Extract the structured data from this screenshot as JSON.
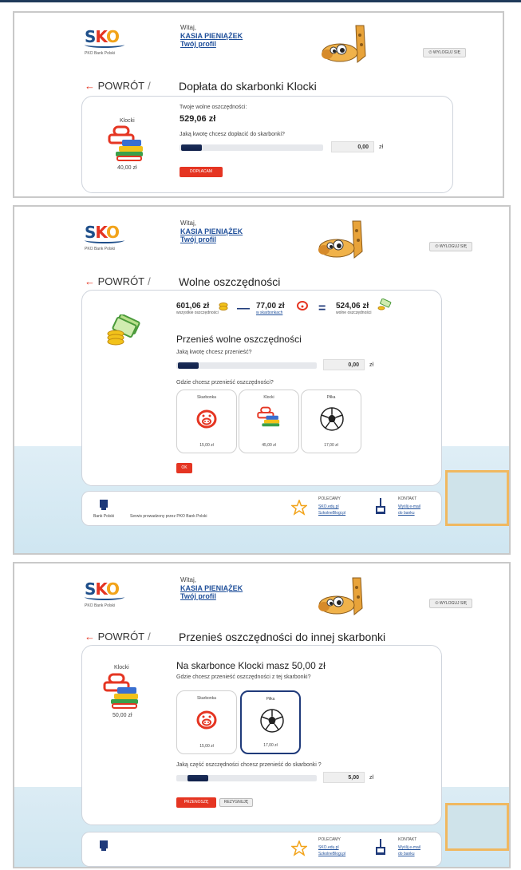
{
  "common": {
    "logo_text": [
      "S",
      "K",
      "O"
    ],
    "logo_sub": "PKO Bank Polski",
    "greeting": "Witaj,",
    "user_name": "KASIA PIENIĄŻEK",
    "profile_link": "Twój profil",
    "logout_label": "WYLOGUJ SIĘ",
    "back_label": "POWRÓT",
    "slash": "/",
    "currency": "zł",
    "colors": {
      "red": "#e53522",
      "navy": "#1f3a7a",
      "accent_blue": "#1f4f9a"
    }
  },
  "panel1": {
    "title": "Dopłata do skarbonki Klocki",
    "item_name": "Klocki",
    "item_value": "40,00 zł",
    "free_label": "Twoje wolne oszczędności:",
    "free_amount": "529,06 zł",
    "question": "Jaką kwotę chcesz dopłacić do skarbonki?",
    "amount": "0,00",
    "button": "DOPŁACAM"
  },
  "panel2": {
    "title": "Wolne oszczędności",
    "sum_all": "601,06 zł",
    "sum_all_label": "wszystkie oszczędności",
    "minus": "—",
    "sum_piggy": "77,00 zł",
    "sum_piggy_label": "w skarbonkach",
    "equals": "=",
    "sum_free": "524,06 zł",
    "sum_free_label": "wolne oszczędności",
    "heading": "Przenieś wolne oszczędności",
    "question": "Jaką kwotę chcesz przenieść?",
    "amount": "0,00",
    "where_question": "Gdzie chcesz przenieść oszczędności?",
    "tiles": [
      {
        "name": "Skarbonka",
        "value": "15,00 zł",
        "icon": "piggy-icon"
      },
      {
        "name": "Klocki",
        "value": "45,00 zł",
        "icon": "blocks-icon"
      },
      {
        "name": "Piłka",
        "value": "17,00 zł",
        "icon": "ball-icon"
      }
    ],
    "button": "OK",
    "footer": {
      "bank": "Bank Polski",
      "service": "Serwis prowadzony przez PKO Bank Polski",
      "recommend_label": "POLECAMY",
      "recommend_link1": "SKO.edu.pl",
      "recommend_link2": "SzkolneBlogi.pl",
      "contact_label": "KONTAKT",
      "contact_link1": "Wyślij e-mail",
      "contact_link2": "do banku"
    }
  },
  "panel3": {
    "title": "Przenieś oszczędności do innej skarbonki",
    "item_name": "Klocki",
    "item_value": "50,00 zł",
    "heading": "Na skarbonce Klocki masz 50,00 zł",
    "where_question": "Gdzie chcesz przenieść oszczędności z tej skarbonki?",
    "tiles": [
      {
        "name": "Skarbonka",
        "value": "15,00 zł",
        "icon": "piggy-icon"
      },
      {
        "name": "Piłka",
        "value": "17,00 zł",
        "icon": "ball-icon"
      }
    ],
    "question": "Jaką część oszczędności chcesz przenieść do skarbonki ?",
    "amount": "5,00",
    "button_primary": "PRZENOSZĘ",
    "button_secondary": "REZYGNUJĘ",
    "footer": {
      "recommend_label": "POLECAMY",
      "recommend_link1": "SKO.edu.pl",
      "recommend_link2": "SzkolneBlogi.pl",
      "contact_label": "KONTAKT",
      "contact_link1": "Wyślij e-mail",
      "contact_link2": "do banku"
    }
  }
}
